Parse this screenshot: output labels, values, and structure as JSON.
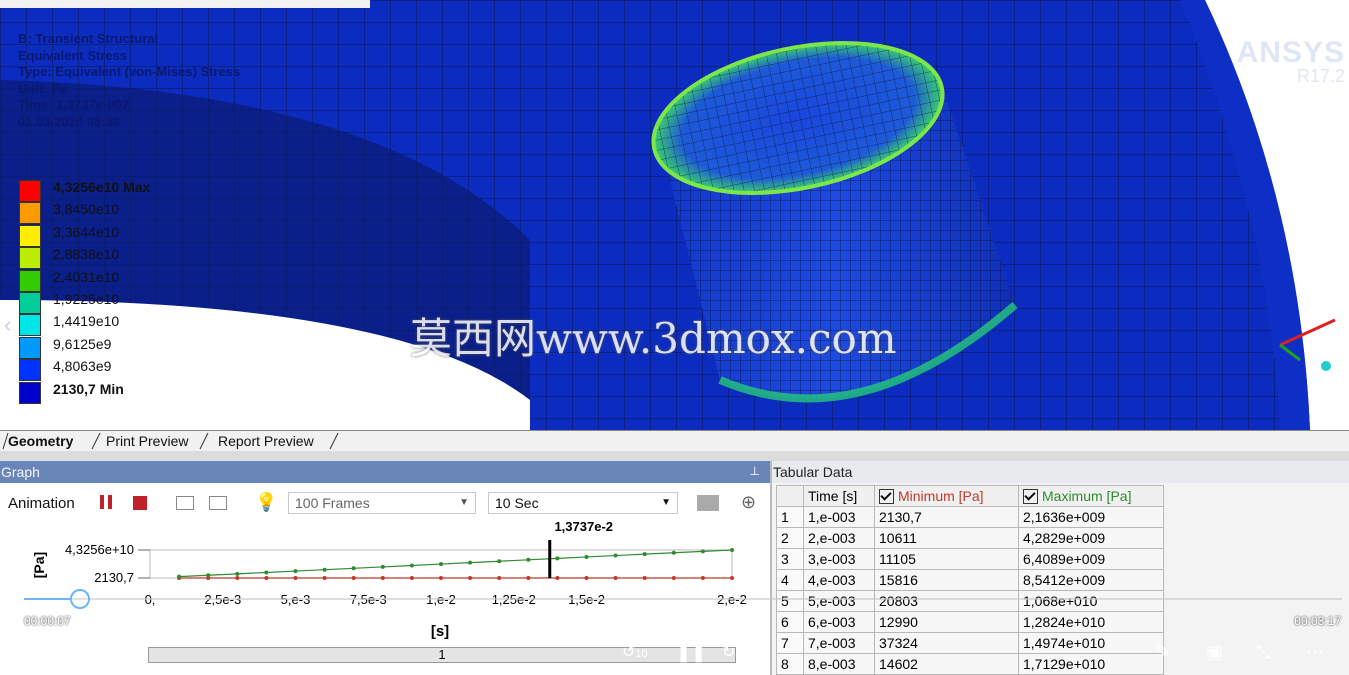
{
  "viewport": {
    "info": [
      "B: Transient Structural",
      "Equivalent Stress",
      "Type: Equivalent (von-Mises) Stress",
      "Unit: Pa",
      "Time: 1,3737e-002",
      "01.03.2020 08:38"
    ],
    "legend": {
      "labels": [
        "4,3256e10 Max",
        "3,8450e10",
        "3,3644e10",
        "2,8838e10",
        "2,4031e10",
        "1,9225e10",
        "1,4419e10",
        "9,6125e9",
        "4,8063e9",
        "2130,7 Min"
      ],
      "colors": [
        "#ff0000",
        "#ff9900",
        "#ffee00",
        "#bbee00",
        "#33cc00",
        "#00cc99",
        "#00e6e6",
        "#0099ff",
        "#0033ff",
        "#0000cc"
      ]
    },
    "brand": "ANSYS",
    "version": "R17.2",
    "watermark": "莫西网www.3dmox.com"
  },
  "tabs": [
    "Geometry",
    "Print Preview",
    "Report Preview"
  ],
  "graph": {
    "title": "Graph",
    "animation_label": "Animation",
    "frames": "100 Frames",
    "duration": "10 Sec",
    "chart_data": {
      "type": "line",
      "ylabel": "[Pa]",
      "xlabel": "[s]",
      "y_ticks": [
        "4,3256e+10",
        "2130,7"
      ],
      "x_ticks": [
        "0,",
        "2,5e-3",
        "5,e-3",
        "7,5e-3",
        "1,e-2",
        "1,25e-2",
        "1,5e-2",
        "2,e-2"
      ],
      "cursor_label": "1,3737e-2",
      "cursor_x": 0.013737,
      "xlim": [
        0,
        0.02
      ],
      "ylim": [
        2130.7,
        43256000000
      ],
      "series": [
        {
          "name": "Minimum [Pa]",
          "color": "#c0392b",
          "x": [
            0.001,
            0.002,
            0.003,
            0.004,
            0.005,
            0.006,
            0.007,
            0.008,
            0.009,
            0.01,
            0.011,
            0.012,
            0.013,
            0.014,
            0.015,
            0.016,
            0.017,
            0.018,
            0.019,
            0.02
          ],
          "y": [
            2130.7,
            10611,
            11105,
            15816,
            20803,
            12990,
            37324,
            14602,
            18000,
            20000,
            22000,
            24000,
            26000,
            28000,
            30000,
            32000,
            34000,
            36000,
            38000,
            40000
          ]
        },
        {
          "name": "Maximum [Pa]",
          "color": "#2e8b2e",
          "x": [
            0.001,
            0.002,
            0.003,
            0.004,
            0.005,
            0.006,
            0.007,
            0.008,
            0.009,
            0.01,
            0.011,
            0.012,
            0.013,
            0.014,
            0.015,
            0.016,
            0.017,
            0.018,
            0.019,
            0.02
          ],
          "y": [
            2163600000,
            4282900000,
            6408900000,
            8541200000,
            10680000000,
            12824000000,
            14974000000,
            17129000000,
            19300000000,
            21500000000,
            23700000000,
            25900000000,
            28100000000,
            30300000000,
            32500000000,
            34700000000,
            36900000000,
            39000000000,
            41100000000,
            43256000000
          ]
        }
      ]
    },
    "slider_value": "1"
  },
  "tabular": {
    "title": "Tabular Data",
    "headers": [
      "Time [s]",
      "Minimum [Pa]",
      "Maximum [Pa]"
    ],
    "header_colors": [
      "#111111",
      "#c0392b",
      "#2e8b2e"
    ],
    "rows": [
      [
        "1",
        "1,e-003",
        "2130,7",
        "2,1636e+009"
      ],
      [
        "2",
        "2,e-003",
        "10611",
        "4,2829e+009"
      ],
      [
        "3",
        "3,e-003",
        "11105",
        "6,4089e+009"
      ],
      [
        "4",
        "4,e-003",
        "15816",
        "8,5412e+009"
      ],
      [
        "5",
        "5,e-003",
        "20803",
        "1,068e+010"
      ],
      [
        "6",
        "6,e-003",
        "12990",
        "1,2824e+010"
      ],
      [
        "7",
        "7,e-003",
        "37324",
        "1,4974e+010"
      ],
      [
        "8",
        "8,e-003",
        "14602",
        "1,7129e+010"
      ]
    ]
  },
  "player": {
    "elapsed": "00:00:07",
    "total": "00:03:17",
    "rewind_label": "10",
    "forward_label": "30",
    "progress": 0.035
  }
}
